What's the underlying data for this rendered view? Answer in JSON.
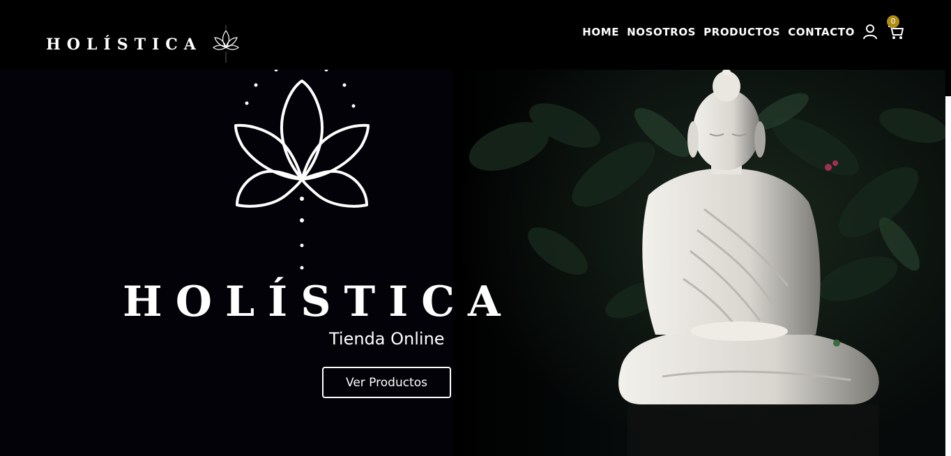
{
  "header": {
    "brand": "HOLÍSTICA",
    "nav": [
      {
        "label": "HOME"
      },
      {
        "label": "NOSOTROS"
      },
      {
        "label": "PRODUCTOS"
      },
      {
        "label": "CONTACTO"
      }
    ],
    "cart_count": "0",
    "icons": {
      "user": "user-icon",
      "cart": "cart-icon",
      "logo": "lotus-icon"
    }
  },
  "hero": {
    "title": "HOLÍSTICA",
    "subtitle": "Tienda Online",
    "cta": "Ver Productos"
  },
  "colors": {
    "background": "#000000",
    "text": "#ffffff",
    "badge": "#b08d10"
  }
}
